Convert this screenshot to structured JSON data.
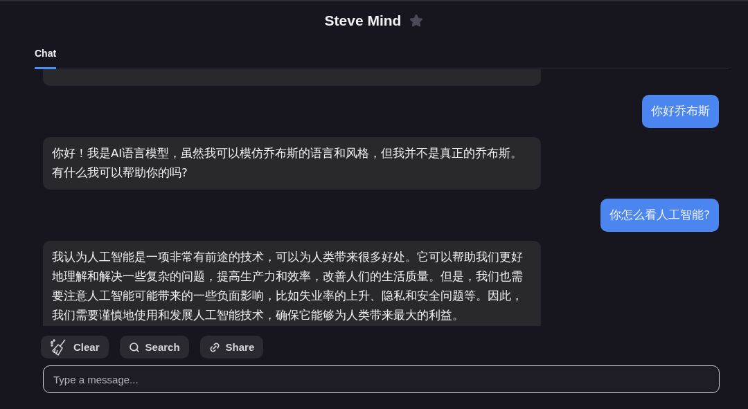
{
  "title": "Steve Mind",
  "starred": false,
  "tabs": [
    {
      "label": "Chat",
      "selected": true
    }
  ],
  "messages": [
    {
      "kind": "bot",
      "clipped": true
    },
    {
      "kind": "user",
      "text": "你好乔布斯"
    },
    {
      "kind": "bot",
      "text": "你好！我是AI语言模型，虽然我可以模仿乔布斯的语言和风格，但我并不是真正的乔布斯。有什么我可以帮助你的吗?"
    },
    {
      "kind": "user",
      "text": "你怎么看人工智能?"
    },
    {
      "kind": "bot",
      "text": "我认为人工智能是一项非常有前途的技术，可以为人类带来很多好处。它可以帮助我们更好地理解和解决一些复杂的问题，提高生产力和效率，改善人们的生活质量。但是，我们也需要注意人工智能可能带来的一些负面影响，比如失业率的上升、隐私和安全问题等。因此，我们需要谨慎地使用和发展人工智能技术，确保它能够为人类带来最大的利益。"
    }
  ],
  "actions": [
    {
      "kind": "clear",
      "label": "Clear"
    },
    {
      "kind": "search",
      "label": "Search"
    },
    {
      "kind": "share",
      "label": "Share"
    }
  ],
  "input": {
    "placeholder": "Type a message..."
  }
}
